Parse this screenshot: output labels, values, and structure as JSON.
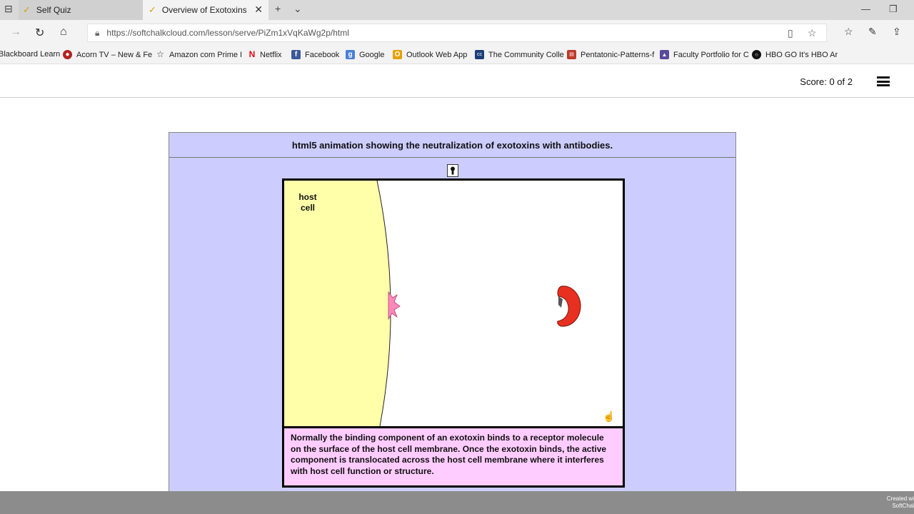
{
  "browser": {
    "tabs": [
      {
        "label": "Self Quiz",
        "active": false
      },
      {
        "label": "Overview of Exotoxins",
        "active": true
      }
    ],
    "new_tab_glyph": "+",
    "url": "https://softchalkcloud.com/lesson/serve/PiZm1xVqKaWg2p/html",
    "favorites": [
      {
        "label": "Blackboard Learn",
        "icon": ""
      },
      {
        "label": "Acorn TV – New & Fe",
        "icon": "tv"
      },
      {
        "label": "Amazon com  Prime I",
        "icon": "star"
      },
      {
        "label": "Netflix",
        "icon": "N"
      },
      {
        "label": "Facebook",
        "icon": "f"
      },
      {
        "label": "Google",
        "icon": "g"
      },
      {
        "label": "Outlook Web App",
        "icon": "O"
      },
      {
        "label": "The Community Colle",
        "icon": "cc"
      },
      {
        "label": "Pentatonic-Patterns-f",
        "icon": "pdf"
      },
      {
        "label": "Faculty Portfolio for C",
        "icon": "fp"
      },
      {
        "label": "HBO GO   It's HBO  Ar",
        "icon": "hbo"
      }
    ]
  },
  "lesson": {
    "score": "Score: 0 of 2"
  },
  "animation": {
    "title": "html5 animation showing the neutralization of exotoxins with antibodies.",
    "host_label_line1": "host",
    "host_label_line2": "cell",
    "caption": "Normally the binding component of an exotoxin binds to a receptor molecule on the surface of the host cell membrane. Once the exotoxin binds, the active component is translocated across the host cell membrane where it interferes with host cell function or structure.",
    "colors": {
      "panel_bg": "#ccccff",
      "host_cell": "#ffffaa",
      "receptor": "#ff88bb",
      "exotoxin": "#e83020",
      "caption_bg": "#ffccff"
    }
  },
  "footer": {
    "credit_line1": "Created wi",
    "credit_line2": "SoftChal"
  }
}
